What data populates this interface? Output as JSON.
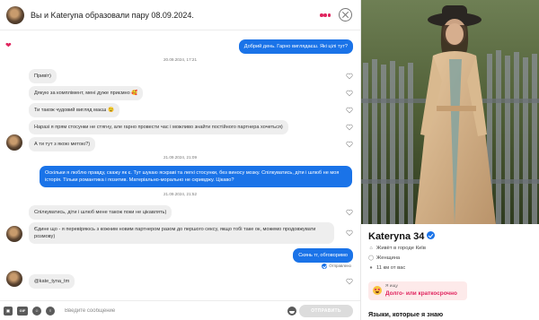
{
  "header": {
    "title": "Вы и Kateryna образовали пару 08.09.2024.",
    "menu_icon": "more-dots-icon",
    "close_icon": "close-icon"
  },
  "messages": [
    {
      "type": "out",
      "text": "Добрий день. Гарно виглядаєш. Які цілі тут?"
    },
    {
      "type": "date",
      "text": "20.09.2024, 17:21"
    },
    {
      "type": "in",
      "text": "Привіт)"
    },
    {
      "type": "in",
      "text": "Дякую за комплімент, мені дуже приємно 🥰"
    },
    {
      "type": "in",
      "text": "Ти також чудовий вигляд маєш 😉"
    },
    {
      "type": "in",
      "text": "Наразі я прям стосунки не стягну, але гарно провести час і можливо знайти постійного партнера хочеться)"
    },
    {
      "type": "in",
      "text": "А ти тут з якою метою?)"
    },
    {
      "type": "date",
      "text": "21.09.2024, 21:09"
    },
    {
      "type": "out",
      "text": "Оскільки я люблю правду, скажу як є. Тут шукаю яскраві та легкі стосунки, без виносу мозку. Спілкуватись, діти і шлюб не моя історія. Тільки романтика і позитив. Матеріально-морально не скривджу. Цікаво?"
    },
    {
      "type": "date",
      "text": "21.09.2024, 21:52"
    },
    {
      "type": "in",
      "text": "Спілкуватись, діти і шлюб мене також поки не цікавлять)"
    },
    {
      "type": "in",
      "text": "Єдине що - я перевіряюсь з кожним новим партнером разом до першого сексу, якщо тобі таке ок, можемо продовжувати розмову)"
    },
    {
      "type": "out",
      "text": "Скинь тг, обговоримо"
    },
    {
      "type": "status",
      "text": "Отправлено"
    },
    {
      "type": "in",
      "text": "@kate_tyna_tm"
    }
  ],
  "composer": {
    "placeholder": "Введите сообщение",
    "send_label": "ОТПРАВИТЬ",
    "tools": [
      "camera-icon",
      "gif-icon",
      "sticker-icon",
      "audio-icon"
    ]
  },
  "profile": {
    "name": "Kateryna",
    "age": "34",
    "location": "Живёт в городе Київ",
    "gender": "Женщина",
    "distance": "11 км от вас",
    "seeking_label": "Я ищу",
    "seeking_value": "Долго- или краткосрочно",
    "languages_title": "Языки, которые я знаю"
  },
  "colors": {
    "accent_blue": "#1a73e8",
    "accent_pink": "#e0245e",
    "bubble_in": "#eeeeee",
    "seek_bg": "#fdeaea"
  }
}
